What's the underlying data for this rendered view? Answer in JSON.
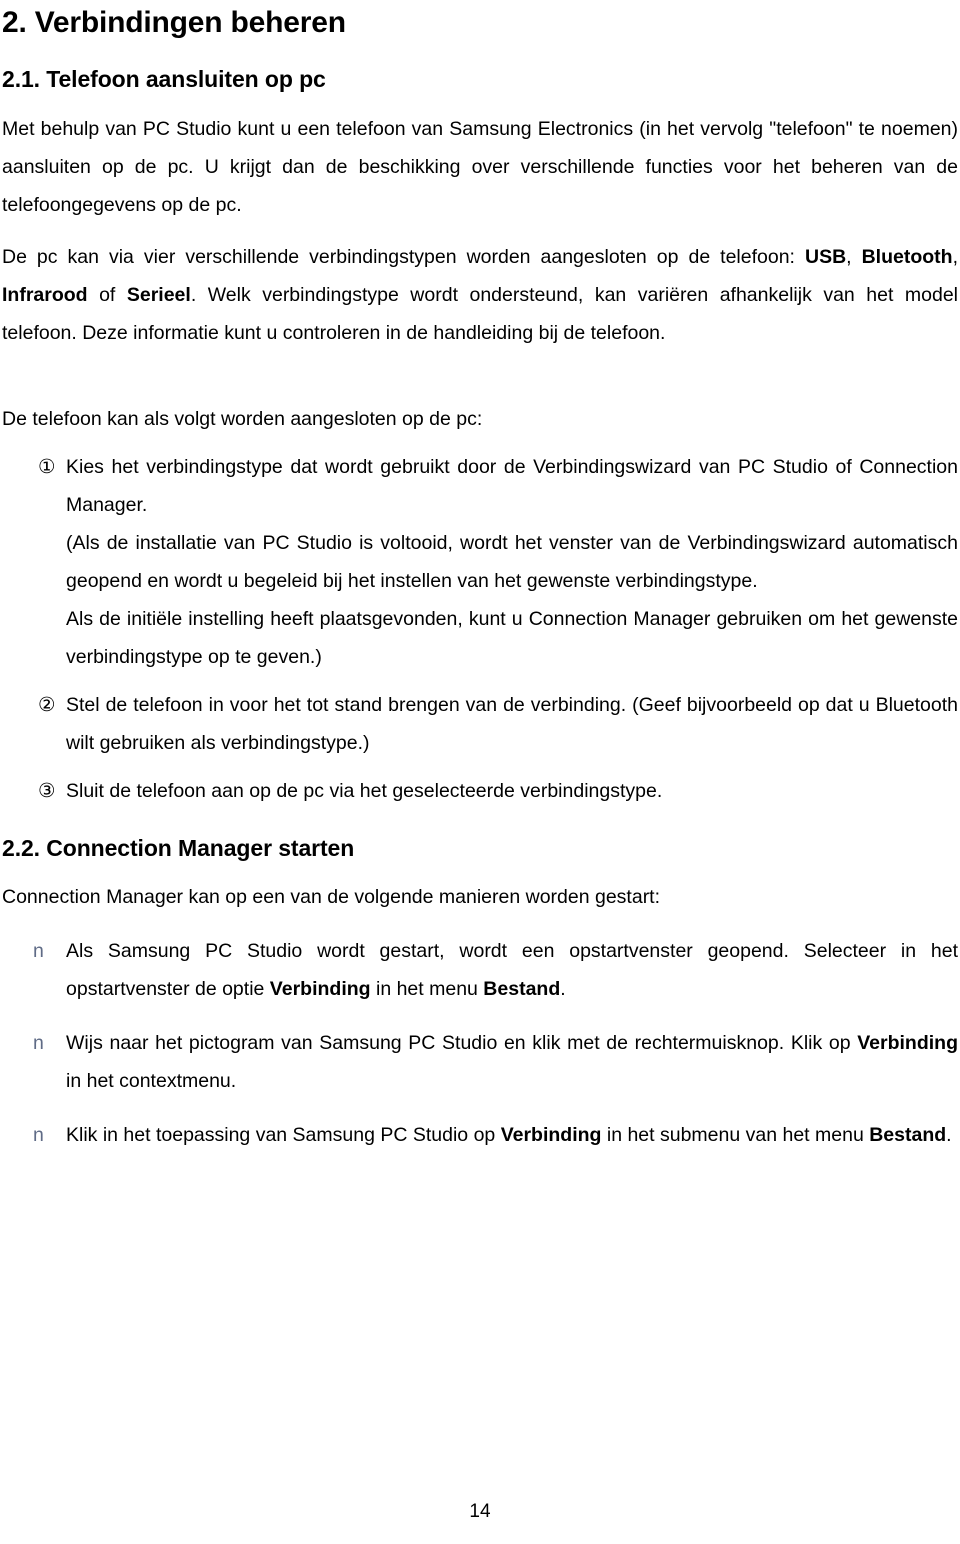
{
  "document": {
    "heading1": "2. Verbindingen beheren",
    "heading2_1": "2.1. Telefoon aansluiten op pc",
    "heading2_2": "2.2. Connection Manager starten",
    "page_number": "14",
    "bullet_glyph": "n",
    "bullet_color": "#5f6b86"
  },
  "section21": {
    "para1_a": "Met behulp van PC Studio kunt u een telefoon van Samsung Electronics (in het vervolg \"telefoon\" te noemen) aansluiten op de pc. U krijgt dan de beschikking over verschillende functies voor het beheren van de telefoongegevens op de pc.",
    "para2_part1": "De pc kan via vier verschillende verbindingstypen worden aangesloten op de telefoon: ",
    "para2_bold1": "USB",
    "para2_part2": ", ",
    "para2_bold2": "Bluetooth",
    "para2_part3": ", ",
    "para2_bold3": "Infrarood",
    "para2_part4": " of ",
    "para2_bold4": "Serieel",
    "para2_part5": ". Welk verbindingstype wordt ondersteund, kan variëren afhankelijk van het model telefoon. Deze informatie kunt u controleren in de handleiding bij de telefoon.",
    "intro": "De telefoon kan als volgt worden aangesloten op de pc:",
    "items": [
      {
        "marker": "①",
        "text": "Kies het verbindingstype dat wordt gebruikt door de Verbindingswizard van PC Studio of Connection Manager.",
        "sub": [
          "(Als de installatie van PC Studio is voltooid, wordt het venster van de Verbindingswizard automatisch geopend en wordt u begeleid bij het instellen van het gewenste verbindingstype.",
          "Als de initiële instelling heeft plaatsgevonden, kunt u Connection Manager gebruiken om het gewenste verbindingstype op te geven.)"
        ]
      },
      {
        "marker": "②",
        "text": "Stel de telefoon in voor het tot stand brengen van de verbinding. (Geef bijvoorbeeld op dat u Bluetooth wilt gebruiken als verbindingstype.)",
        "sub": []
      },
      {
        "marker": "③",
        "text": "Sluit de telefoon aan op de pc via het geselecteerde verbindingstype.",
        "sub": []
      }
    ]
  },
  "section22": {
    "lead": "Connection Manager kan op een van de volgende manieren worden gestart:",
    "bullets": [
      {
        "part1": "Als Samsung PC Studio wordt gestart, wordt een opstartvenster geopend. Selecteer in het opstartvenster de optie ",
        "bold1": "Verbinding",
        "part2": " in het menu ",
        "bold2": "Bestand",
        "part3": "."
      },
      {
        "part1": "Wijs naar het pictogram van Samsung PC Studio en klik met de rechtermuisknop. Klik op ",
        "bold1": "Verbinding",
        "part2": " in het contextmenu.",
        "bold2": "",
        "part3": ""
      },
      {
        "part1": "Klik in het toepassing van Samsung PC Studio op ",
        "bold1": "Verbinding",
        "part2": " in het submenu van het menu ",
        "bold2": "Bestand",
        "part3": "."
      }
    ]
  }
}
